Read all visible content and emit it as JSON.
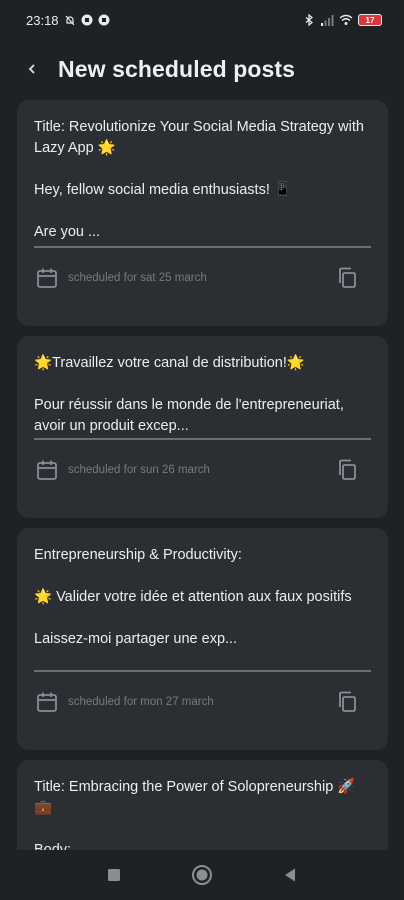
{
  "status_bar": {
    "time": "23:18",
    "battery": "17"
  },
  "header": {
    "title": "New scheduled posts"
  },
  "posts": [
    {
      "text": "Title: Revolutionize Your Social Media Strategy with Lazy App 🌟\n\nHey, fellow social media enthusiasts! 📱\n\nAre you ...",
      "scheduled": "scheduled for sat 25 march"
    },
    {
      "text": "🌟Travaillez votre canal de distribution!🌟\n\nPour réussir dans le monde de l'entrepreneuriat, avoir un produit excep...",
      "scheduled": "scheduled for sun 26 march"
    },
    {
      "text": "Entrepreneurship & Productivity:\n\n🌟 Valider votre idée et attention aux faux positifs\n\nLaissez-moi partager une exp...",
      "scheduled": "scheduled for mon 27 march"
    },
    {
      "text": "Title: Embracing the Power of Solopreneurship 🚀💼\n\nBody:",
      "scheduled": ""
    }
  ],
  "icons": {
    "back": "chevron-left-icon",
    "calendar": "calendar-icon",
    "copy": "copy-icon"
  },
  "colors": {
    "background": "#1f2225",
    "card": "#2b2e32",
    "muted_text": "#777b81"
  }
}
